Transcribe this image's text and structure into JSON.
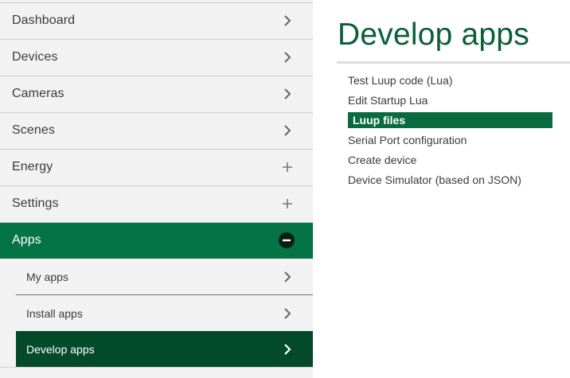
{
  "sidebar": {
    "items": [
      {
        "label": "Dashboard",
        "icon": "chevron-right-icon"
      },
      {
        "label": "Devices",
        "icon": "chevron-right-icon"
      },
      {
        "label": "Cameras",
        "icon": "chevron-right-icon"
      },
      {
        "label": "Scenes",
        "icon": "chevron-right-icon"
      },
      {
        "label": "Energy",
        "icon": "plus-icon"
      },
      {
        "label": "Settings",
        "icon": "plus-icon"
      },
      {
        "label": "Apps",
        "icon": "minus-circle-icon",
        "active": true
      }
    ],
    "subitems": [
      {
        "label": "My apps",
        "icon": "chevron-right-icon"
      },
      {
        "label": "Install apps",
        "icon": "chevron-right-icon"
      },
      {
        "label": "Develop apps",
        "icon": "chevron-right-icon",
        "active": true
      }
    ]
  },
  "main": {
    "title": "Develop apps",
    "links": [
      {
        "label": "Test Luup code (Lua)"
      },
      {
        "label": "Edit Startup Lua"
      },
      {
        "label": "Luup files",
        "selected": true
      },
      {
        "label": "Serial Port configuration"
      },
      {
        "label": "Create device"
      },
      {
        "label": "Device Simulator (based on JSON)"
      }
    ]
  },
  "colors": {
    "accent": "#047346",
    "accent_dark": "#034a2b",
    "title": "#0b5e3a",
    "selected_link": "#0b6b40",
    "sidebar_bg": "#f2f2f2"
  }
}
